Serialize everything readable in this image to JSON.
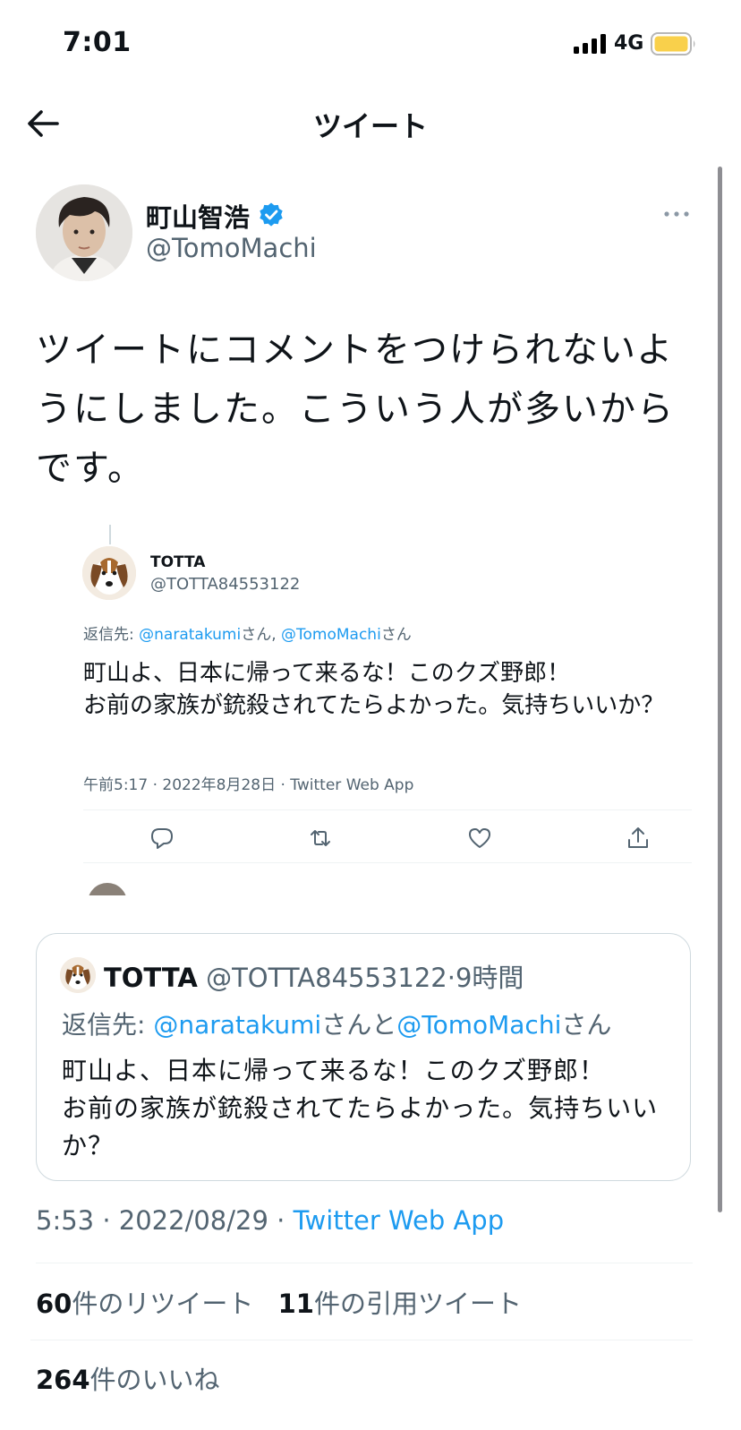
{
  "status_bar": {
    "time": "7:01",
    "network": "4G",
    "battery_color": "#f9d04b"
  },
  "nav": {
    "title": "ツイート"
  },
  "author": {
    "name": "町山智浩",
    "handle": "@TomoMachi"
  },
  "tweet": {
    "text": "ツイートにコメントをつけられないようにしました。こういう人が多いからです。",
    "timestamp_time": "5:53",
    "timestamp_sep1": " · ",
    "timestamp_date": "2022/08/29",
    "timestamp_sep2": " · ",
    "source": "Twitter Web App"
  },
  "embedded_screenshot": {
    "name": "TOTTA",
    "handle": "@TOTTA84553122",
    "reply_prefix": "返信先: ",
    "reply_user1": "@naratakumi",
    "reply_sep": "さん, ",
    "reply_user2": "@TomoMachi",
    "reply_suffix": "さん",
    "text": "町山よ、日本に帰って来るな！このクズ野郎！\nお前の家族が銃殺されてたらよかった。気持ちいいか？",
    "meta": "午前5:17 · 2022年8月28日 · Twitter Web App",
    "actions": [
      "reply-icon",
      "retweet-icon",
      "like-icon",
      "share-icon"
    ]
  },
  "quote": {
    "name": "TOTTA",
    "handle": "@TOTTA84553122",
    "dot": "·",
    "age": "9時間",
    "reply_prefix": "返信先: ",
    "reply_user1": "@naratakumi",
    "reply_mid": "さんと",
    "reply_user2": "@TomoMachi",
    "reply_suffix": "さん",
    "text": "町山よ、日本に帰って来るな！このクズ野郎！\nお前の家族が銃殺されてたらよかった。気持ちいいか？"
  },
  "stats": {
    "retweets_count": "60",
    "retweets_label": "件のリツイート",
    "quotes_count": "11",
    "quotes_label": "件の引用ツイート",
    "likes_count": "264",
    "likes_label": "件のいいね"
  },
  "colors": {
    "accent": "#1d9bf0",
    "secondary_text": "#536471",
    "divider": "#eff3f4"
  }
}
